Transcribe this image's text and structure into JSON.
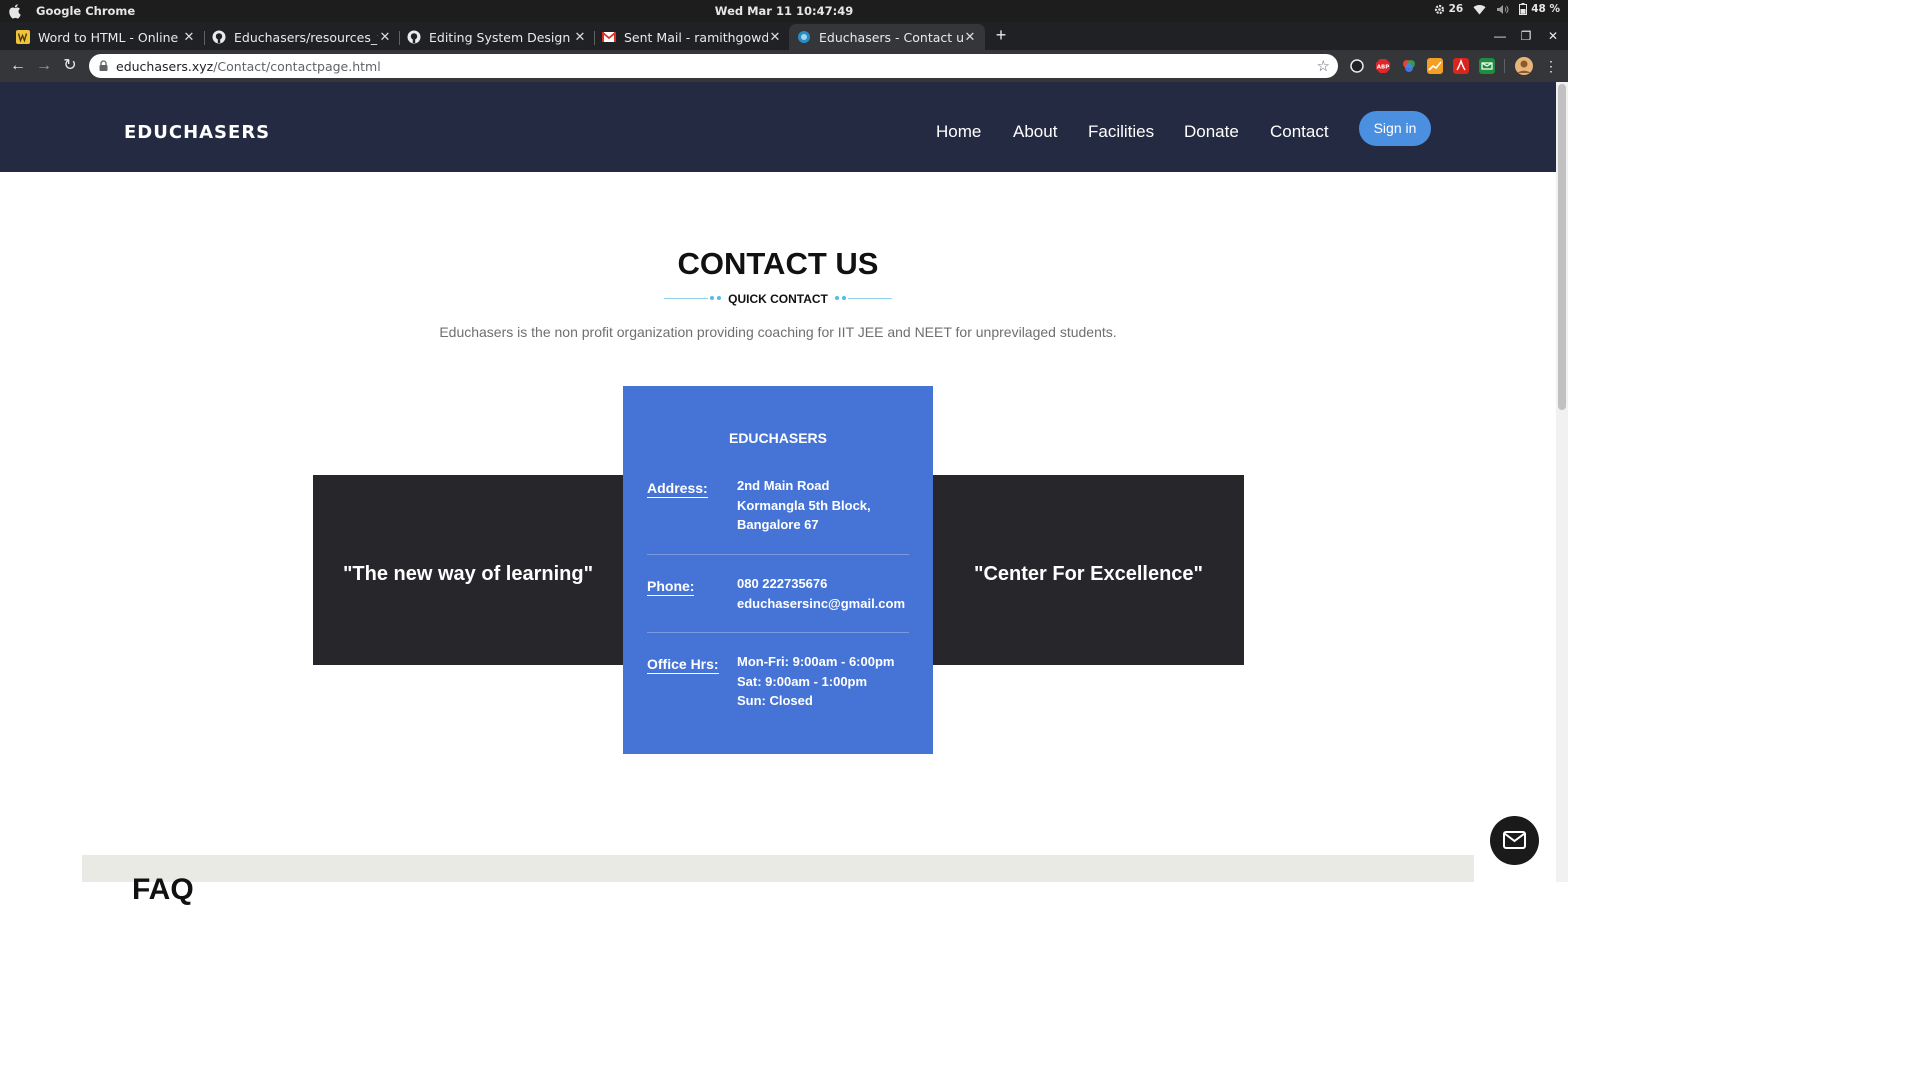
{
  "os": {
    "app_name": "Google Chrome",
    "clock": "Wed Mar 11  10:47:49",
    "weather_value": "26",
    "battery": "48 %"
  },
  "browser": {
    "tabs": [
      {
        "title": "Word to HTML - Online Converter",
        "favicon": "w-logo-icon"
      },
      {
        "title": "Educhasers/resources_website",
        "favicon": "github-icon"
      },
      {
        "title": "Editing System Design · ramithgowda",
        "favicon": "github-icon"
      },
      {
        "title": "Sent Mail - ramithgowdak",
        "favicon": "gmail-icon"
      },
      {
        "title": "Educhasers - Contact us",
        "favicon": "site-icon"
      }
    ],
    "url_host": "educhasers.xyz",
    "url_path": "/Contact/contactpage.html"
  },
  "site": {
    "brand": "EDUCHASERS",
    "nav": [
      "Home",
      "About",
      "Facilities",
      "Donate",
      "Contact"
    ],
    "sign_in": "Sign in"
  },
  "contact": {
    "title": "CONTACT US",
    "subtitle": "QUICK CONTACT",
    "tagline": "Educhasers is the non profit organization providing coaching for IIT JEE and NEET for unprevilaged students.",
    "left_quote": "\"The new way of learning\"",
    "right_quote": "\"Center For Excellence\"",
    "card": {
      "title": "EDUCHASERS",
      "address_label": "Address:",
      "address_lines": [
        "2nd Main Road",
        "Kormangla 5th Block,",
        "Bangalore 67"
      ],
      "phone_label": "Phone:",
      "phone_lines": [
        "080 222735676",
        "educhasersinc@gmail.com"
      ],
      "hours_label": "Office Hrs:",
      "hours_lines": [
        "Mon-Fri: 9:00am - 6:00pm",
        "Sat: 9:00am - 1:00pm",
        "Sun: Closed"
      ]
    }
  },
  "faq": {
    "heading": "FAQ"
  },
  "colors": {
    "nav_bg": "#242a42",
    "card_blue": "#4674d6",
    "dark_panel": "#26262b",
    "sign_in_blue": "#4b8fe0"
  }
}
